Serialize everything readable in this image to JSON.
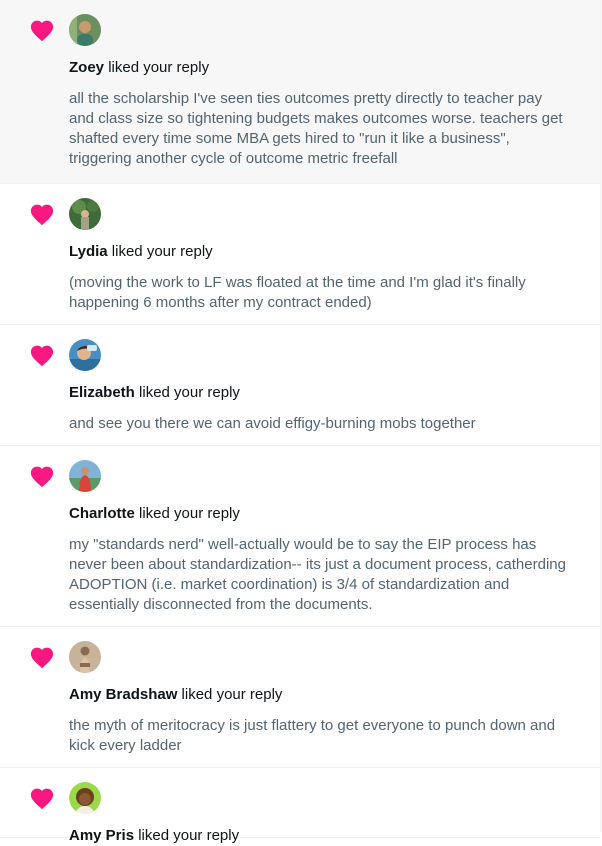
{
  "notifications": [
    {
      "name": "Zoey",
      "action": "liked your reply",
      "text": "all the scholarship I've seen ties outcomes pretty directly to teacher pay and class size so tightening budgets makes outcomes worse. teachers get shafted every time some MBA gets hired to \"run it like a business\", triggering another cycle of outcome metric freefall",
      "avatar_icon": "user-avatar-photo",
      "avatar_colors": [
        "#6b8f5e",
        "#c89a6e"
      ]
    },
    {
      "name": "Lydia",
      "action": "liked your reply",
      "text": "(moving the work to LF was floated at the time and I'm glad it's finally happening 6 months after my contract ended)",
      "avatar_icon": "user-avatar-photo",
      "avatar_colors": [
        "#3f6b3a",
        "#a3a08a"
      ]
    },
    {
      "name": "Elizabeth",
      "action": "liked your reply",
      "text": "and see you there we can avoid effigy-burning mobs together",
      "avatar_icon": "user-avatar-photo",
      "avatar_colors": [
        "#4a8fc4",
        "#e0b48f"
      ]
    },
    {
      "name": "Charlotte",
      "action": "liked your reply",
      "text": "my \"standards nerd\" well-actually would be to say the EIP process has never been about standardization-- its just a document process, catherding ADOPTION (i.e. market coordination) is 3/4 of standardization and essentially disconnected from the documents.",
      "avatar_icon": "user-avatar-photo",
      "avatar_colors": [
        "#7fb3d8",
        "#d8453a"
      ]
    },
    {
      "name": "Amy Bradshaw",
      "action": "liked your reply",
      "text": "the myth of meritocracy is just flattery to get everyone to punch down and kick every ladder",
      "avatar_icon": "user-avatar-photo",
      "avatar_colors": [
        "#c7b29a",
        "#8a6a52"
      ]
    },
    {
      "name": "Amy Pris",
      "action": "liked your reply",
      "text": "",
      "avatar_icon": "user-avatar-illustration",
      "avatar_colors": [
        "#9bd84a",
        "#6b3f1f"
      ]
    }
  ],
  "heart_icon": "heart-icon",
  "heart_color": "#f91880",
  "highlight_bg": "#f7f7f7"
}
